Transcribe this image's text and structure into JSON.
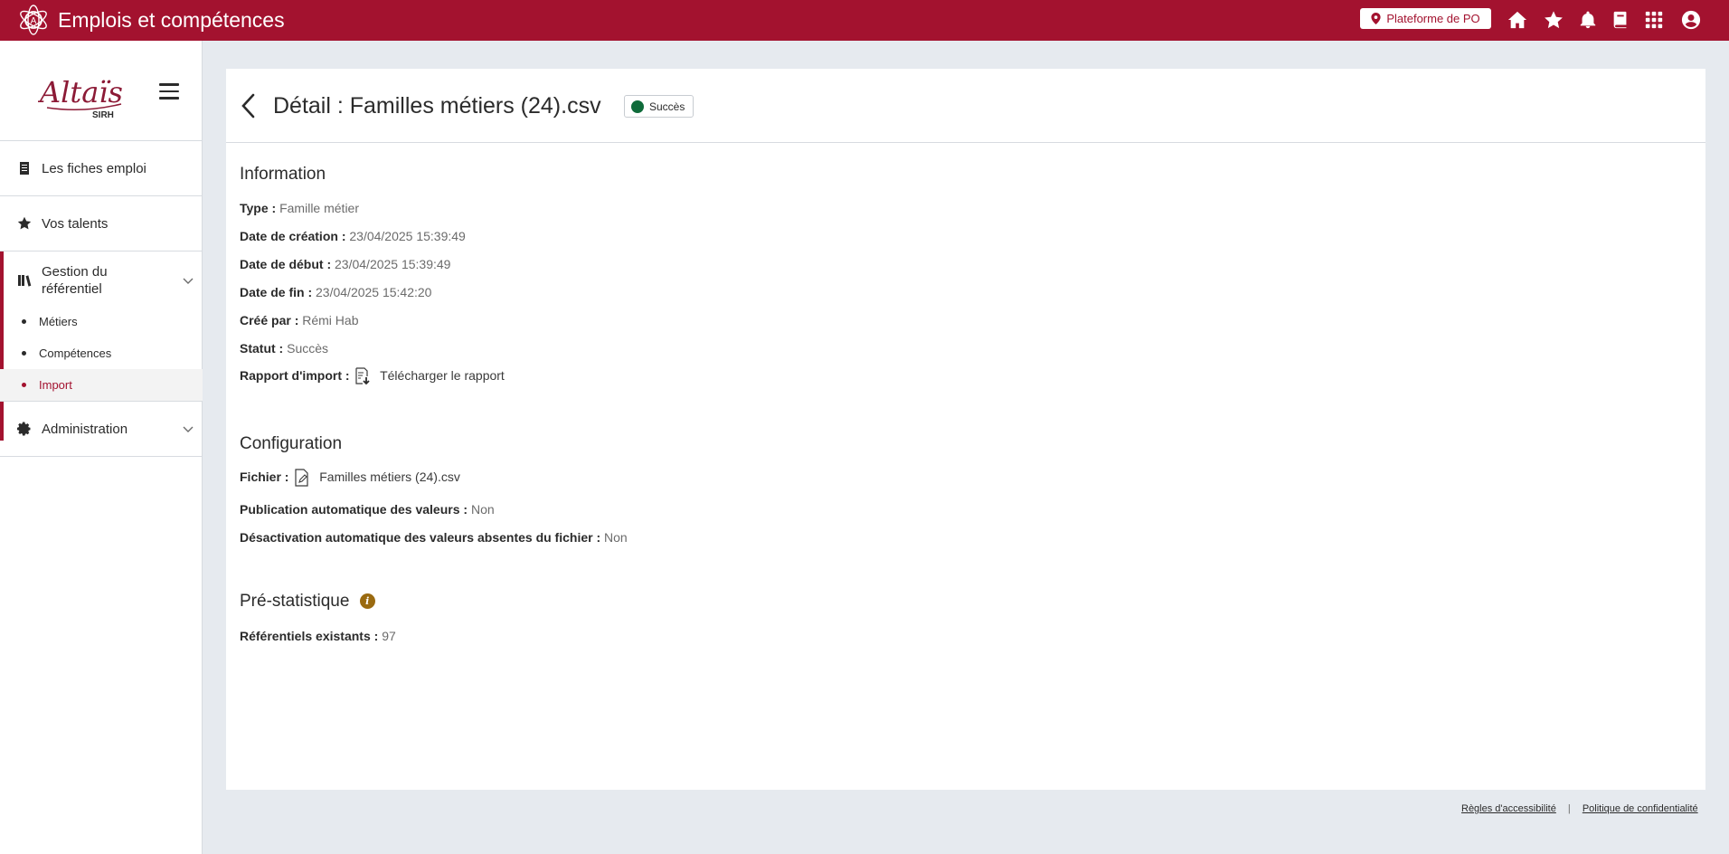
{
  "header": {
    "app_title": "Emplois et compétences",
    "platform_label": "Plateforme de PO",
    "icons": [
      "home-icon",
      "star-icon",
      "bell-icon",
      "book-icon",
      "apps-grid-icon",
      "account-icon"
    ]
  },
  "sidebar": {
    "brand_text": "Altaïs SIRH",
    "items": [
      {
        "label": "Les fiches emploi",
        "icon": "document-icon"
      },
      {
        "label": "Vos talents",
        "icon": "star-icon"
      },
      {
        "label": "Gestion du référentiel",
        "icon": "books-icon",
        "expanded": true
      },
      {
        "label": "Administration",
        "icon": "gear-icon"
      }
    ],
    "subitems": [
      {
        "label": "Métiers"
      },
      {
        "label": "Compétences"
      },
      {
        "label": "Import",
        "active": true
      }
    ]
  },
  "page": {
    "title": "Détail : Familles métiers (24).csv",
    "status_badge": "Succès",
    "status_color": "#0f6b3a"
  },
  "information": {
    "title": "Information",
    "type_label": "Type :",
    "type_value": "Famille métier",
    "created_label": "Date de création :",
    "created_value": "23/04/2025 15:39:49",
    "start_label": "Date de début :",
    "start_value": "23/04/2025 15:39:49",
    "end_label": "Date de fin :",
    "end_value": "23/04/2025 15:42:20",
    "author_label": "Créé par :",
    "author_value": "Rémi Hab",
    "status_label": "Statut :",
    "status_value": "Succès",
    "report_label": "Rapport d'import :",
    "report_link": "Télécharger le rapport"
  },
  "configuration": {
    "title": "Configuration",
    "file_label": "Fichier :",
    "file_value": "Familles métiers (24).csv",
    "autopub_label": "Publication automatique des valeurs :",
    "autopub_value": "Non",
    "autodeact_label": "Désactivation automatique des valeurs absentes du fichier :",
    "autodeact_value": "Non"
  },
  "prestats": {
    "title": "Pré-statistique",
    "existing_label": "Référentiels existants :",
    "existing_value": "97"
  },
  "footer": {
    "accessibility": "Règles d'accessibilité",
    "separator": "|",
    "privacy": "Politique de confidentialité"
  },
  "colors": {
    "brand": "#a3122f",
    "background": "#e6eaef",
    "info_icon": "#9a6a10"
  }
}
